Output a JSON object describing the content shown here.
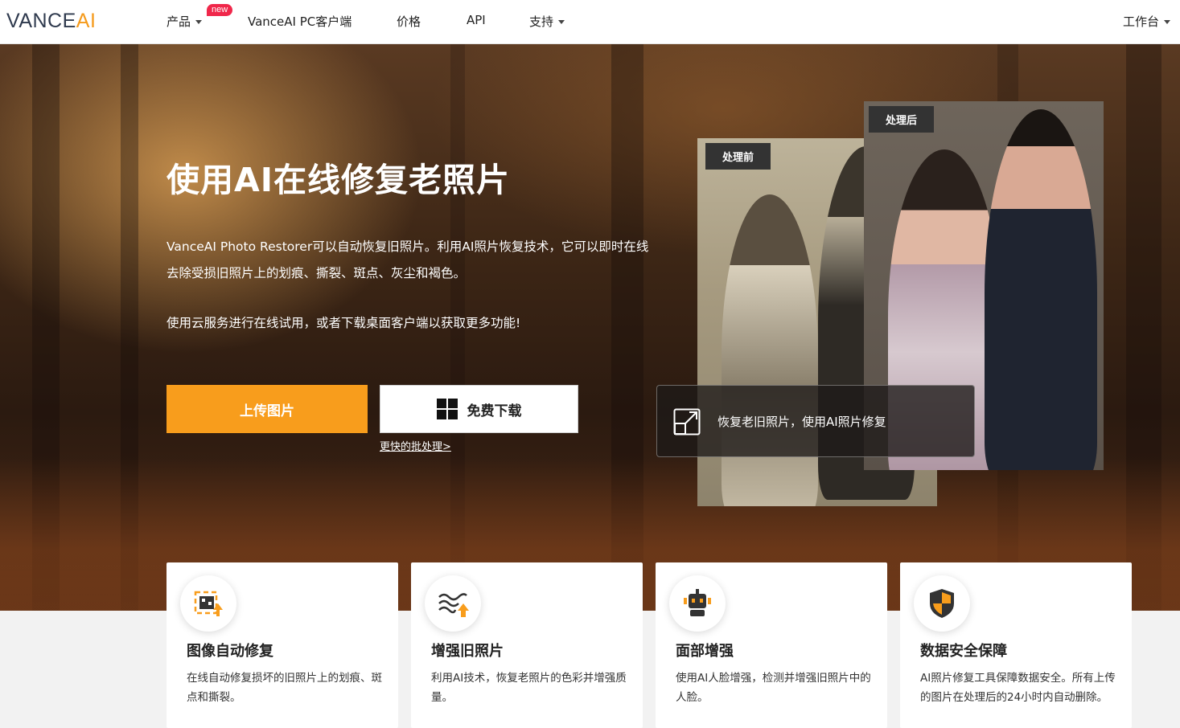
{
  "nav": {
    "logo_vance": "VANCE",
    "logo_ai": "AI",
    "items": [
      {
        "label": "产品"
      },
      {
        "label": "VanceAI PC客户端"
      },
      {
        "label": "价格"
      },
      {
        "label": "API"
      },
      {
        "label": "支持"
      }
    ],
    "new_badge": "new",
    "workspace": "工作台"
  },
  "hero": {
    "title": "使用AI在线修复老照片",
    "description": "VanceAI Photo Restorer可以自动恢复旧照片。利用AI照片恢复技术，它可以即时在线去除受损旧照片上的划痕、撕裂、斑点、灰尘和褐色。",
    "description2": "使用云服务进行在线试用，或者下载桌面客户端以获取更多功能!",
    "upload_button": "上传图片",
    "download_button": "免费下载",
    "batch_link": "更快的批处理>",
    "before_tag": "处理前",
    "after_tag": "处理后",
    "info_text": "恢复老旧照片，使用AI照片修复"
  },
  "features": [
    {
      "icon": "image-repair-icon",
      "title": "图像自动修复",
      "desc": "在线自动修复损坏的旧照片上的划痕、斑点和撕裂。"
    },
    {
      "icon": "enhance-waves-icon",
      "title": "增强旧照片",
      "desc": "利用AI技术，恢复老照片的色彩并增强质量。"
    },
    {
      "icon": "robot-face-icon",
      "title": "面部增强",
      "desc": "使用AI人脸增强，检测并增强旧照片中的人脸。"
    },
    {
      "icon": "shield-icon",
      "title": "数据安全保障",
      "desc": "AI照片修复工具保障数据安全。所有上传的图片在处理后的24小时内自动删除。"
    }
  ],
  "colors": {
    "accent": "#f89d1c",
    "badge": "#f0274a"
  }
}
